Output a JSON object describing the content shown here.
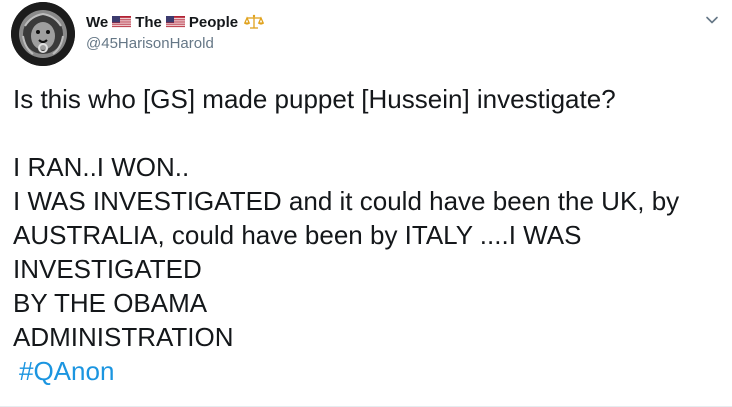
{
  "colors": {
    "name": "#14171a",
    "handle": "#657786",
    "text": "#14171a",
    "hashtag": "#1b95e0",
    "caret": "#657786"
  },
  "user": {
    "name_words": [
      "We",
      "The",
      "People"
    ],
    "name_icons": [
      "us-flag-icon",
      "us-flag-icon",
      "balance-scale-icon"
    ],
    "handle": "@45HarisonHarold",
    "avatar_icon": "lion-head-icon"
  },
  "menu": {
    "caret_icon": "chevron-down-icon"
  },
  "tweet": {
    "question": "Is this who [GS] made puppet [Hussein] investigate?",
    "lines": [
      "I RAN..I WON..",
      "I WAS INVESTIGATED and it could have been the UK, by",
      "AUSTRALIA, could have been by ITALY ....I WAS",
      "INVESTIGATED",
      "BY THE OBAMA",
      "ADMINISTRATION"
    ],
    "hashtag": "#QAnon"
  }
}
